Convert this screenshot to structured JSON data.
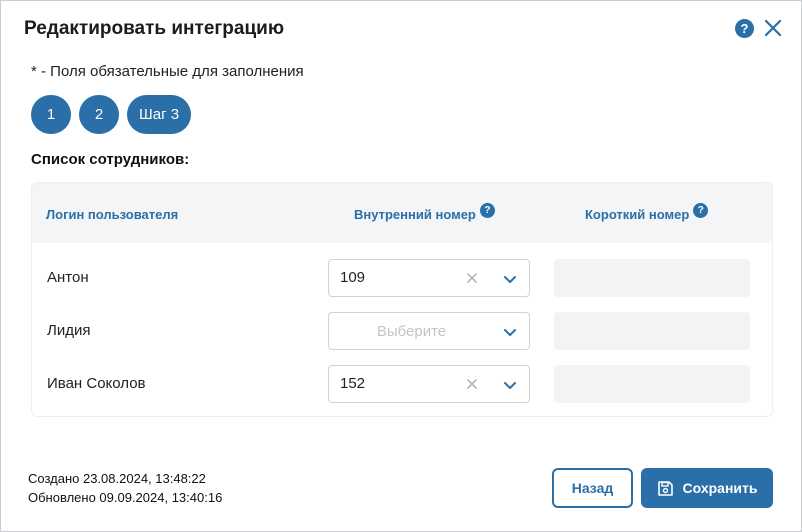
{
  "dialog": {
    "title": "Редактировать интеграцию",
    "help": "?",
    "required_note": "* - Поля обязательные для заполнения"
  },
  "steps": [
    "1",
    "2",
    "Шаг 3"
  ],
  "list_title": "Список сотрудников:",
  "table": {
    "headers": {
      "login": "Логин пользователя",
      "internal": "Внутренний номер",
      "short": "Короткий номер",
      "help": "?"
    },
    "rows": [
      {
        "name": "Антон",
        "internal": "109",
        "placeholder": "",
        "short": ""
      },
      {
        "name": "Лидия",
        "internal": "",
        "placeholder": "Выберите",
        "short": ""
      },
      {
        "name": "Иван Соколов",
        "internal": "152",
        "placeholder": "",
        "short": ""
      }
    ]
  },
  "footer": {
    "created": "Создано 23.08.2024, 13:48:22",
    "updated": "Обновлено 09.09.2024, 13:40:16",
    "back_label": "Назад",
    "save_label": "Сохранить"
  },
  "colors": {
    "accent": "#2a6fa8"
  },
  "icons": {
    "close": "close-icon",
    "help": "help-icon",
    "save": "floppy-disk-icon",
    "clear": "clear-icon",
    "dropdown": "chevron-down-icon"
  }
}
